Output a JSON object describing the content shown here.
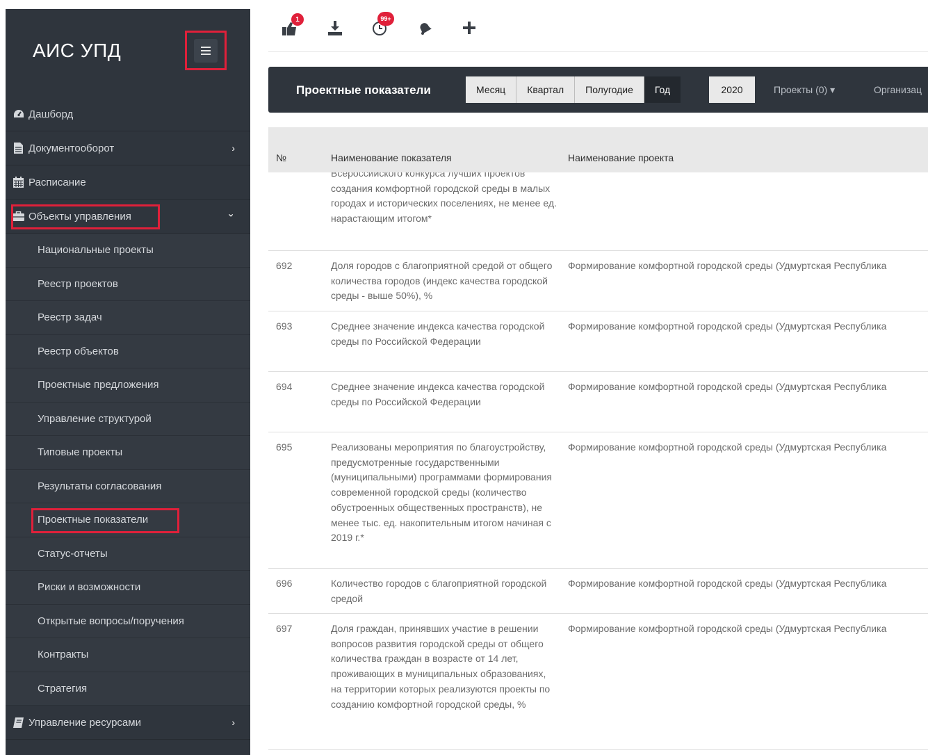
{
  "app": {
    "title": "АИС УПД"
  },
  "sidebar": {
    "top_items": [
      {
        "label": "Дашборд",
        "icon": "dashboard-icon"
      },
      {
        "label": "Документооборот",
        "icon": "file-icon",
        "arrow": "›"
      },
      {
        "label": "Расписание",
        "icon": "calendar-icon"
      },
      {
        "label": "Объекты управления",
        "icon": "briefcase-icon",
        "arrow": "⌄"
      }
    ],
    "sub_items": [
      "Национальные проекты",
      "Реестр проектов",
      "Реестр задач",
      "Реестр объектов",
      "Проектные предложения",
      "Управление структурой",
      "Типовые проекты",
      "Результаты согласования",
      "Проектные показатели",
      "Статус-отчеты",
      "Риски и возможности",
      "Открытые вопросы/поручения",
      "Контракты",
      "Стратегия"
    ],
    "bottom_item": {
      "label": "Управление ресурсами",
      "icon": "book-icon",
      "arrow": "›"
    }
  },
  "topbar": {
    "badges": {
      "messages": "1",
      "tasks": "99+"
    },
    "icons": [
      "messages-icon",
      "download-icon",
      "clock-icon",
      "bell-icon",
      "plus-icon"
    ]
  },
  "header": {
    "title": "Проектные показатели",
    "periods": [
      "Месяц",
      "Квартал",
      "Полугодие",
      "Год"
    ],
    "active_period": "Год",
    "year": "2020",
    "projects_filter": "Проекты (0) ▾",
    "org_filter": "Организац"
  },
  "table": {
    "columns": {
      "num": "№",
      "name": "Наименование показателя",
      "project": "Наименование проекта"
    },
    "first_fragment": "Всероссийского конкурса лучших проектов создания комфортной городской среды в малых городах и исторических поселениях, не менее ед. нарастающим итогом*",
    "rows": [
      {
        "num": "692",
        "name": "Доля городов с благоприятной средой от общего количества городов (индекс качества городской среды - выше 50%), %",
        "project": "Формирование комфортной городской среды (Удмуртская Республика"
      },
      {
        "num": "693",
        "name": "Среднее значение индекса качества городской среды по Российской Федерации",
        "project": "Формирование комфортной городской среды (Удмуртская Республика"
      },
      {
        "num": "694",
        "name": "Среднее значение индекса качества городской среды по Российской Федерации",
        "project": "Формирование комфортной городской среды (Удмуртская Республика"
      },
      {
        "num": "695",
        "name": "Реализованы мероприятия по благоустройству, предусмотренные государственными (муниципальными) программами формирования современной городской среды (количество обустроенных общественных пространств), не менее тыс. ед. накопительным итогом начиная с 2019 г.*",
        "project": "Формирование комфортной городской среды (Удмуртская Республика"
      },
      {
        "num": "696",
        "name": "Количество городов с благоприятной городской средой",
        "project": "Формирование комфортной городской среды (Удмуртская Республика"
      },
      {
        "num": "697",
        "name": "Доля граждан, принявших участие в решении вопросов развития городской среды от общего количества граждан в возрасте от 14 лет, проживающих в муниципальных образованиях, на территории которых реализуются проекты по созданию комфортной городской среды, %",
        "project": "Формирование комфортной городской среды (Удмуртская Республика"
      }
    ]
  },
  "colors": {
    "sidebar_bg": "#2f353d",
    "highlight": "#e0203a",
    "badge": "#e0203a"
  }
}
